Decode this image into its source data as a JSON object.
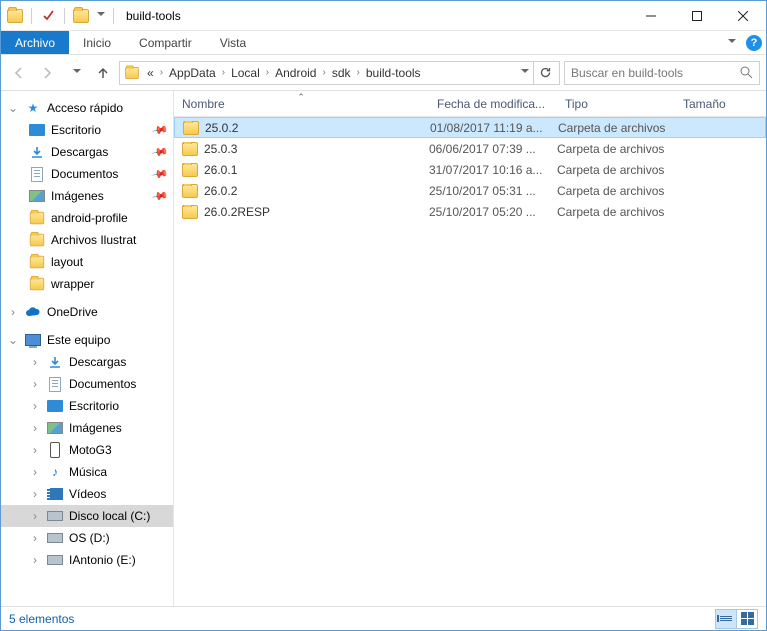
{
  "window": {
    "title": "build-tools"
  },
  "ribbon": {
    "archivo": "Archivo",
    "inicio": "Inicio",
    "compartir": "Compartir",
    "vista": "Vista"
  },
  "breadcrumb": {
    "ell": "«",
    "items": [
      "AppData",
      "Local",
      "Android",
      "sdk",
      "build-tools"
    ]
  },
  "search": {
    "placeholder": "Buscar en build-tools"
  },
  "columns": {
    "name": "Nombre",
    "date": "Fecha de modifica...",
    "type": "Tipo",
    "size": "Tamaño"
  },
  "rows": [
    {
      "name": "25.0.2",
      "date": "01/08/2017 11:19 a...",
      "type": "Carpeta de archivos",
      "selected": true
    },
    {
      "name": "25.0.3",
      "date": "06/06/2017 07:39 ...",
      "type": "Carpeta de archivos",
      "selected": false
    },
    {
      "name": "26.0.1",
      "date": "31/07/2017 10:16 a...",
      "type": "Carpeta de archivos",
      "selected": false
    },
    {
      "name": "26.0.2",
      "date": "25/10/2017 05:31 ...",
      "type": "Carpeta de archivos",
      "selected": false
    },
    {
      "name": "26.0.2RESP",
      "date": "25/10/2017 05:20 ...",
      "type": "Carpeta de archivos",
      "selected": false
    }
  ],
  "navpane": {
    "quick": {
      "label": "Acceso rápido",
      "items": [
        {
          "label": "Escritorio",
          "icon": "desktop",
          "pinned": true
        },
        {
          "label": "Descargas",
          "icon": "downloads",
          "pinned": true
        },
        {
          "label": "Documentos",
          "icon": "doc",
          "pinned": true
        },
        {
          "label": "Imágenes",
          "icon": "img",
          "pinned": true
        },
        {
          "label": "android-profile",
          "icon": "folder",
          "pinned": false
        },
        {
          "label": "Archivos Ilustrat",
          "icon": "folder",
          "pinned": false
        },
        {
          "label": "layout",
          "icon": "folder",
          "pinned": false
        },
        {
          "label": "wrapper",
          "icon": "folder",
          "pinned": false
        }
      ]
    },
    "onedrive": {
      "label": "OneDrive"
    },
    "pc": {
      "label": "Este equipo",
      "items": [
        {
          "label": "Descargas",
          "icon": "downloads"
        },
        {
          "label": "Documentos",
          "icon": "doc"
        },
        {
          "label": "Escritorio",
          "icon": "desktop"
        },
        {
          "label": "Imágenes",
          "icon": "img"
        },
        {
          "label": "MotoG3",
          "icon": "phone"
        },
        {
          "label": "Música",
          "icon": "music"
        },
        {
          "label": "Vídeos",
          "icon": "video"
        },
        {
          "label": "Disco local (C:)",
          "icon": "disk",
          "selected": true
        },
        {
          "label": "OS (D:)",
          "icon": "disk"
        },
        {
          "label": "IAntonio (E:)",
          "icon": "disk"
        }
      ]
    }
  },
  "status": {
    "count": "5 elementos"
  }
}
